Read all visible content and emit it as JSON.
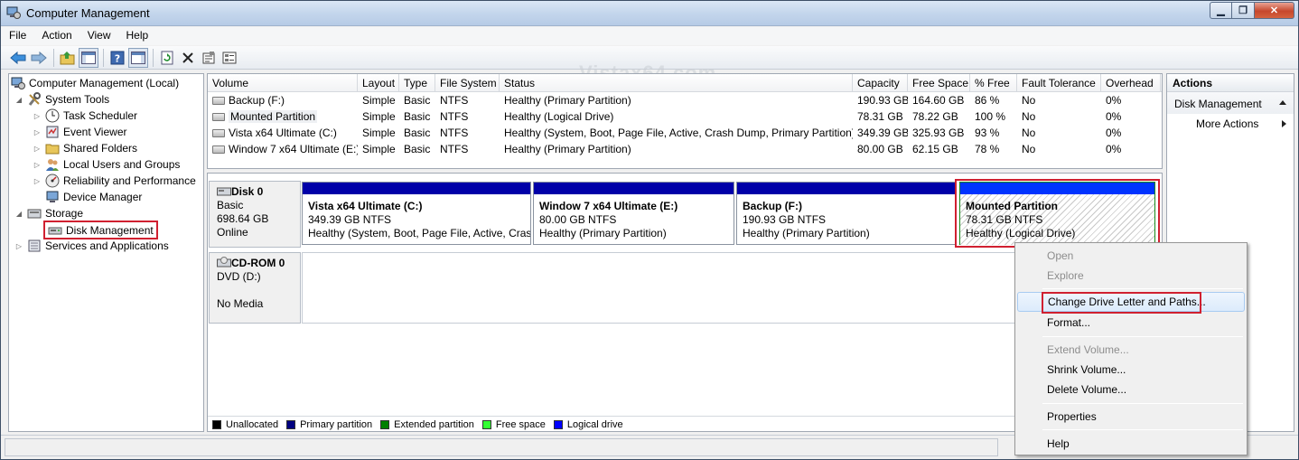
{
  "window": {
    "title": "Computer Management"
  },
  "menu": [
    "File",
    "Action",
    "View",
    "Help"
  ],
  "watermark": "Vistax64.com",
  "tree": [
    {
      "label": "Computer Management (Local)",
      "level": 0,
      "expander": "",
      "icon": "computer-management-icon"
    },
    {
      "label": "System Tools",
      "level": 1,
      "expander": "◢",
      "icon": "tools-icon"
    },
    {
      "label": "Task Scheduler",
      "level": 2,
      "expander": "▷",
      "icon": "clock-icon"
    },
    {
      "label": "Event Viewer",
      "level": 2,
      "expander": "▷",
      "icon": "event-viewer-icon"
    },
    {
      "label": "Shared Folders",
      "level": 2,
      "expander": "▷",
      "icon": "folder-icon"
    },
    {
      "label": "Local Users and Groups",
      "level": 2,
      "expander": "▷",
      "icon": "users-icon"
    },
    {
      "label": "Reliability and Performance",
      "level": 2,
      "expander": "▷",
      "icon": "performance-icon"
    },
    {
      "label": "Device Manager",
      "level": 2,
      "expander": "",
      "icon": "device-manager-icon"
    },
    {
      "label": "Storage",
      "level": 1,
      "expander": "◢",
      "icon": "storage-icon"
    },
    {
      "label": "Disk Management",
      "level": 2,
      "expander": "",
      "icon": "disk-icon",
      "selected": true
    },
    {
      "label": "Services and Applications",
      "level": 1,
      "expander": "▷",
      "icon": "services-icon"
    }
  ],
  "volume_table": {
    "columns": [
      "Volume",
      "Layout",
      "Type",
      "File System",
      "Status",
      "Capacity",
      "Free Space",
      "% Free",
      "Fault Tolerance",
      "Overhead"
    ],
    "rows": [
      [
        "Backup (F:)",
        "Simple",
        "Basic",
        "NTFS",
        "Healthy (Primary Partition)",
        "190.93 GB",
        "164.60 GB",
        "86 %",
        "No",
        "0%"
      ],
      [
        "Mounted Partition",
        "Simple",
        "Basic",
        "NTFS",
        "Healthy (Logical Drive)",
        "78.31 GB",
        "78.22 GB",
        "100 %",
        "No",
        "0%"
      ],
      [
        "Vista x64 Ultimate (C:)",
        "Simple",
        "Basic",
        "NTFS",
        "Healthy (System, Boot, Page File, Active, Crash Dump, Primary Partition)",
        "349.39 GB",
        "325.93 GB",
        "93 %",
        "No",
        "0%"
      ],
      [
        "Window 7 x64 Ultimate (E:)",
        "Simple",
        "Basic",
        "NTFS",
        "Healthy (Primary Partition)",
        "80.00 GB",
        "62.15 GB",
        "78 %",
        "No",
        "0%"
      ]
    ]
  },
  "disk0": {
    "name": "Disk 0",
    "type": "Basic",
    "size": "698.64 GB",
    "state": "Online",
    "partitions": [
      {
        "name": "Vista x64 Ultimate  (C:)",
        "size": "349.39 GB NTFS",
        "status": "Healthy (System, Boot, Page File, Active, Cras"
      },
      {
        "name": "Window 7 x64 Ultimate  (E:)",
        "size": "80.00 GB NTFS",
        "status": "Healthy (Primary Partition)"
      },
      {
        "name": "Backup  (F:)",
        "size": "190.93 GB NTFS",
        "status": "Healthy (Primary Partition)"
      },
      {
        "name": "Mounted Partition",
        "size": "78.31 GB NTFS",
        "status": "Healthy (Logical Drive)"
      }
    ]
  },
  "cdrom0": {
    "name": "CD-ROM 0",
    "type": "DVD (D:)",
    "media": "No Media"
  },
  "legend": [
    {
      "label": "Unallocated",
      "color": "#000000"
    },
    {
      "label": "Primary partition",
      "color": "#000080"
    },
    {
      "label": "Extended partition",
      "color": "#008000"
    },
    {
      "label": "Free space",
      "color": "#33ff33"
    },
    {
      "label": "Logical drive",
      "color": "#0000ff"
    }
  ],
  "actions": {
    "header": "Actions",
    "section": "Disk Management",
    "more": "More Actions"
  },
  "context_menu": {
    "open": "Open",
    "explore": "Explore",
    "change_letter": "Change Drive Letter and Paths...",
    "format": "Format...",
    "extend": "Extend Volume...",
    "shrink": "Shrink Volume...",
    "delete": "Delete Volume...",
    "properties": "Properties",
    "help": "Help"
  },
  "colors": {
    "primary": "#0000a8",
    "logical": "#0033ff",
    "highlight": "#d02030"
  }
}
